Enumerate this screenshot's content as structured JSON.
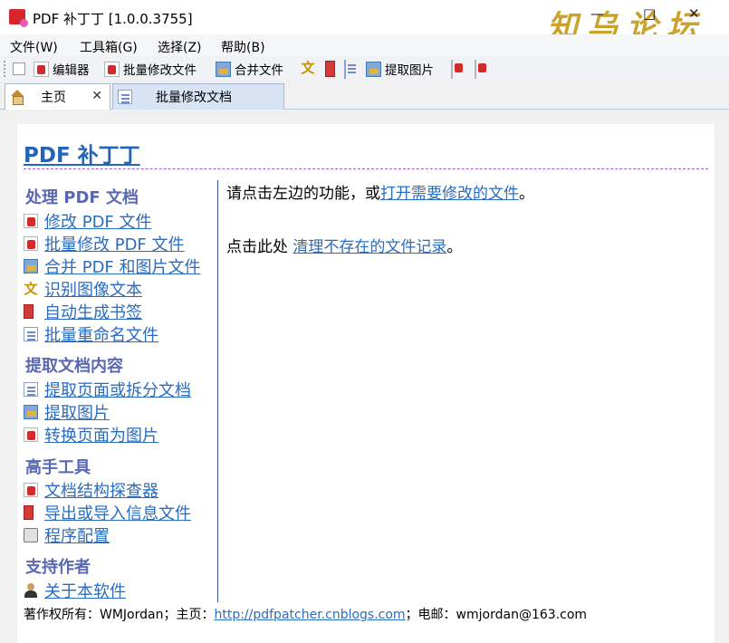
{
  "window": {
    "title": "PDF 补丁丁 [1.0.0.3755]",
    "watermark": "知乌论坛",
    "minimize": "—",
    "maximize": "□",
    "close": "✕"
  },
  "menu": {
    "items": [
      "文件(W)",
      "工具箱(G)",
      "选择(Z)",
      "帮助(B)"
    ]
  },
  "toolbar": {
    "editor": "编辑器",
    "batch_edit": "批量修改文件",
    "merge": "合并文件",
    "extract_images": "提取图片"
  },
  "tabs": [
    {
      "label": "主页",
      "close": "✕"
    },
    {
      "label": "批量修改文档"
    }
  ],
  "page": {
    "title": "PDF 补丁丁",
    "sections": [
      {
        "heading": "处理 PDF 文档",
        "links": [
          "修改 PDF 文件",
          "批量修改 PDF 文件",
          "合并 PDF 和图片文件",
          "识别图像文本",
          "自动生成书签",
          "批量重命名文件"
        ]
      },
      {
        "heading": "提取文档内容",
        "links": [
          "提取页面或拆分文档",
          "提取图片",
          "转换页面为图片"
        ]
      },
      {
        "heading": "高手工具",
        "links": [
          "文档结构探查器",
          "导出或导入信息文件",
          "程序配置"
        ]
      },
      {
        "heading": "支持作者",
        "links": [
          "关于本软件"
        ]
      }
    ],
    "main": {
      "line1_prefix": "请点击左边的功能，或",
      "line1_link": "打开需要修改的文件",
      "line1_suffix": "。",
      "line2_prefix": "点击此处 ",
      "line2_link": "清理不存在的文件记录",
      "line2_suffix": "。"
    },
    "footer": {
      "prefix": "著作权所有：WMJordan；主页：",
      "homepage": "http://pdfpatcher.cnblogs.com",
      "suffix": "；电邮：wmjordan@163.com"
    }
  },
  "colors": {
    "link": "#2a6cc0",
    "section_heading": "#5a68b3",
    "title": "#2264b8",
    "watermark": "#c49a16"
  }
}
